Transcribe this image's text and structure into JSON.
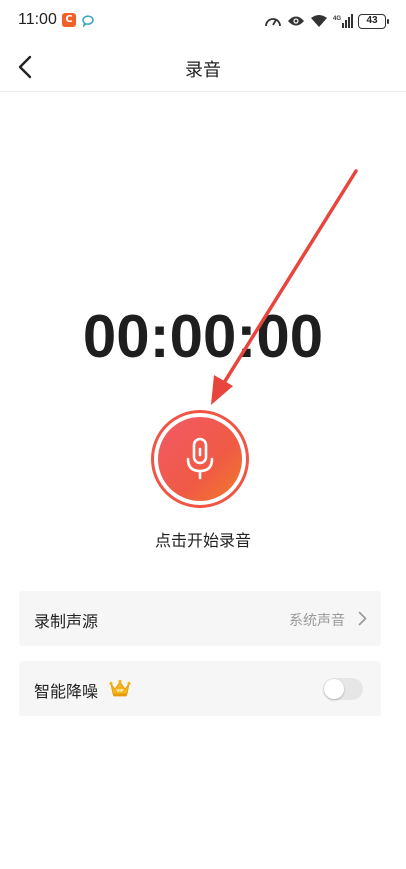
{
  "status_bar": {
    "time": "11:00",
    "battery": "43",
    "network": "4G"
  },
  "header": {
    "title": "录音"
  },
  "timer": {
    "value": "00:00:00"
  },
  "record": {
    "label": "点击开始录音"
  },
  "settings": {
    "source": {
      "label": "录制声源",
      "value": "系统声音"
    },
    "noise_reduction": {
      "label": "智能降噪",
      "badge": "VIP",
      "enabled": false
    }
  },
  "colors": {
    "accent": "#f05a45",
    "annotation_arrow": "#e8453c"
  }
}
